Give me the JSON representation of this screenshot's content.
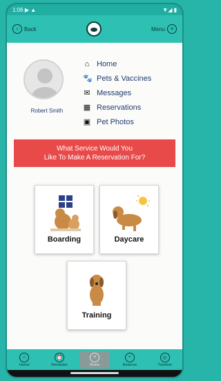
{
  "status": {
    "time": "1:06",
    "left_icons": "▶ ▲",
    "right_icons": "▼◢ ▮"
  },
  "header": {
    "back_label": "Back",
    "menu_label": "Menu"
  },
  "user": {
    "name": "Robert Smith"
  },
  "menu": [
    {
      "label": "Home",
      "icon": "home-icon",
      "glyph": "⌂"
    },
    {
      "label": "Pets & Vaccines",
      "icon": "paw-icon",
      "glyph": "🐾"
    },
    {
      "label": "Messages",
      "icon": "envelope-icon",
      "glyph": "✉"
    },
    {
      "label": "Reservations",
      "icon": "calendar-icon",
      "glyph": "▦"
    },
    {
      "label": "Pet Photos",
      "icon": "photo-icon",
      "glyph": "▣"
    }
  ],
  "banner": {
    "line1": "What Service Would You",
    "line2": "Like To Make A Reservation For?"
  },
  "services": [
    {
      "label": "Boarding",
      "icon": "boarding-dogs-icon"
    },
    {
      "label": "Daycare",
      "icon": "daycare-dog-icon"
    },
    {
      "label": "Training",
      "icon": "training-dog-icon"
    }
  ],
  "nav": [
    {
      "label": "Home",
      "glyph": "⌂"
    },
    {
      "label": "Reminder",
      "glyph": "⏰"
    },
    {
      "label": "Share",
      "glyph": "≡"
    },
    {
      "label": "Reserve",
      "glyph": "+"
    },
    {
      "label": "Timeline",
      "glyph": "◎"
    }
  ],
  "colors": {
    "teal": "#2ec0b2",
    "banner_red": "#e84a4a",
    "dog_brown": "#c98a45"
  }
}
